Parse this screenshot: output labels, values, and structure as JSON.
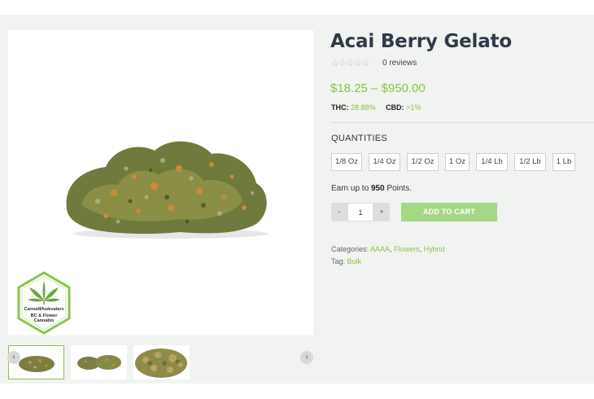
{
  "product": {
    "title": "Acai Berry Gelato",
    "rating_stars": "☆☆☆☆☆",
    "reviews_label": "0 reviews",
    "price_range": "$18.25 – $950.00",
    "thc_label": "THC:",
    "thc_value": "28.88%",
    "cbd_label": "CBD:",
    "cbd_value": ">1%"
  },
  "quantities": {
    "label": "QUANTITIES",
    "options": [
      "1/8 Oz",
      "1/4 Oz",
      "1/2 Oz",
      "1 Oz",
      "1/4 Lb",
      "1/2 Lb",
      "1 Lb"
    ]
  },
  "points": {
    "prefix": "Earn up to",
    "amount": "950",
    "suffix": "Points."
  },
  "cart": {
    "minus": "-",
    "quantity": "1",
    "plus": "+",
    "add_label": "ADD TO CART"
  },
  "meta": {
    "categories_label": "Categories:",
    "categories": [
      "AAAA",
      "Flowers",
      "Hybrid"
    ],
    "tag_label": "Tag:",
    "tag": "Bulk"
  },
  "badge": {
    "brand": "CannaWholesalers",
    "line1": "BC & Flower",
    "line2": "Cannabis"
  },
  "gallery": {
    "prev_icon": "‹",
    "next_icon": "›"
  },
  "colors": {
    "accent": "#8bc34a",
    "button": "#a5d884",
    "background": "#f0f3f0"
  }
}
